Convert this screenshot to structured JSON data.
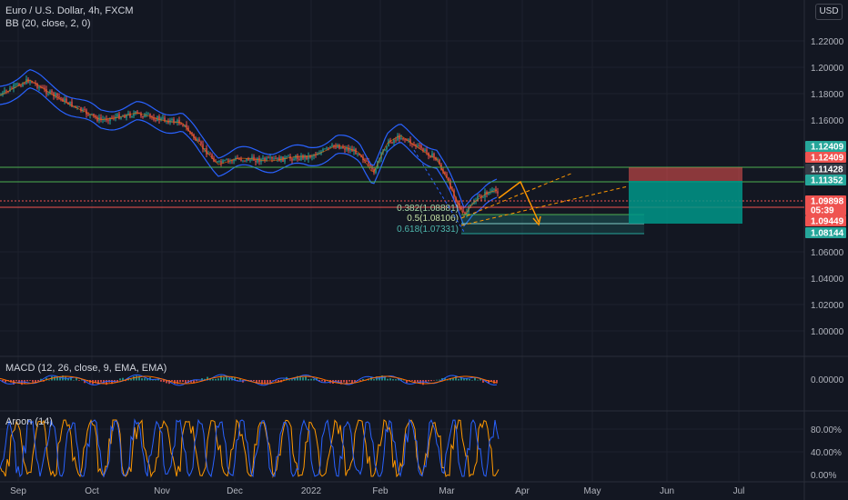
{
  "header": {
    "symbol": "Euro / U.S. Dollar, 4h, FXCM",
    "indicator": "BB (20, close, 2, 0)",
    "currency": "USD"
  },
  "panes": {
    "macd_label": "MACD (12, 26, close, 9, EMA, EMA)",
    "aroon_label": "Aroon (14)"
  },
  "price_axis": [
    "1.22000",
    "1.20000",
    "1.18000",
    "1.16000",
    "1.06000",
    "1.04000",
    "1.02000",
    "1.00000"
  ],
  "price_tags": [
    {
      "text": "1.12409",
      "color": "#26a69a",
      "text_color": "#ffffff"
    },
    {
      "text": "1.12409",
      "color": "#ef5350",
      "text_color": "#ffffff"
    },
    {
      "text": "1.11428",
      "color": "#363a45",
      "text_color": "#ffffff"
    },
    {
      "text": "1.11352",
      "color": "#26a69a",
      "text_color": "#ffffff"
    },
    {
      "text": "1.09898",
      "color": "#ef5350",
      "text_color": "#ffffff"
    },
    {
      "text": "05:39",
      "color": "#ef5350",
      "text_color": "#ffffff"
    },
    {
      "text": "1.09449",
      "color": "#ef5350",
      "text_color": "#ffffff"
    },
    {
      "text": "1.08144",
      "color": "#26a69a",
      "text_color": "#ffffff"
    }
  ],
  "macd_axis": [
    "0.00000"
  ],
  "aroon_axis": [
    "80.00%",
    "40.00%",
    "0.00%"
  ],
  "time_axis": [
    "Sep",
    "Oct",
    "Nov",
    "Dec",
    "2022",
    "Feb",
    "Mar",
    "Apr",
    "May",
    "Jun",
    "Jul"
  ],
  "fib_labels": [
    "0.382(1.08881)",
    "0.5(1.08106)",
    "0.618(1.07331)"
  ],
  "colors": {
    "background": "#131722",
    "grid": "#1e222d",
    "bollinger": "#2962ff",
    "macd_line": "#2962ff",
    "signal_line": "#ff6d00",
    "aroon_up": "#ff9800",
    "aroon_down": "#2962ff",
    "up": "#26a69a",
    "down": "#ef5350"
  }
}
